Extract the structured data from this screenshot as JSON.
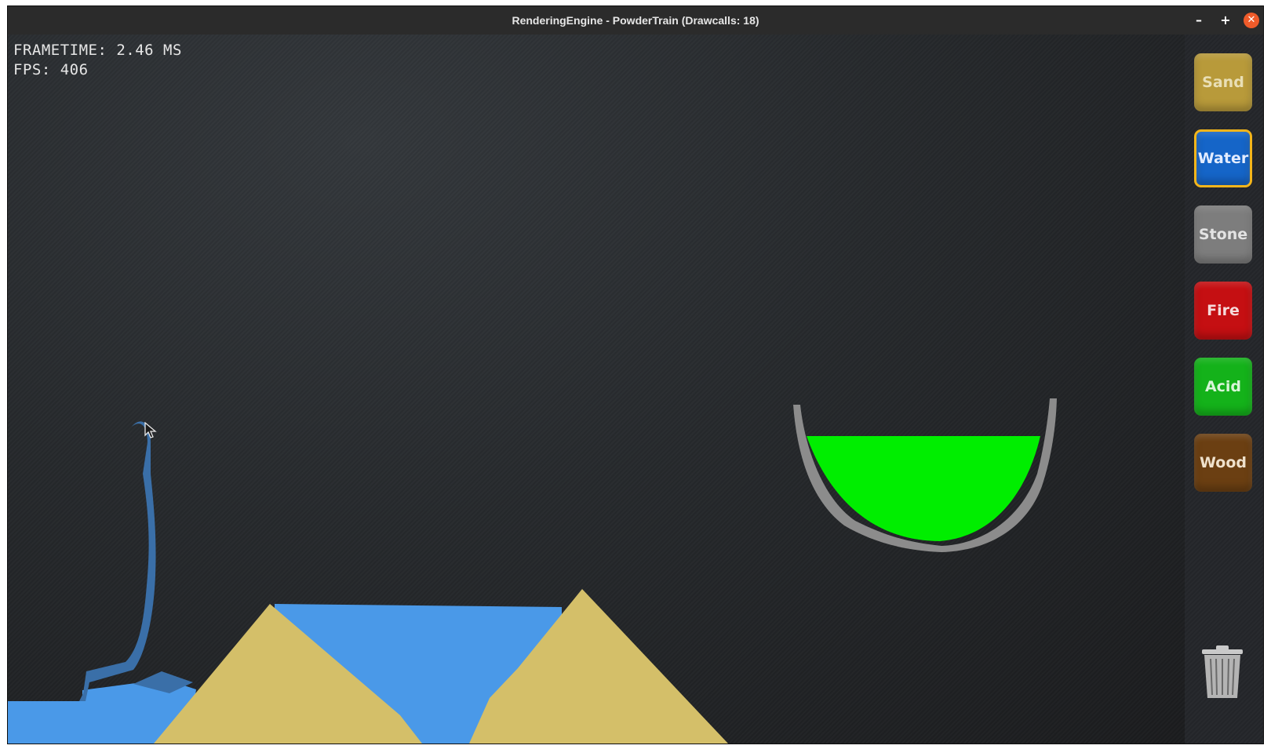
{
  "window": {
    "title": "RenderingEngine - PowderTrain (Drawcalls: 18)",
    "minimize_label": "–",
    "maximize_label": "+",
    "close_label": "✕"
  },
  "hud": {
    "frametime": "FRAMETIME: 2.46 MS",
    "fps": "FPS: 406"
  },
  "materials": [
    {
      "label": "Sand",
      "color": "#b89a3a",
      "text_color": "#e9dfb6",
      "selected": false
    },
    {
      "label": "Water",
      "color": "#1565c8",
      "text_color": "#e2ecff",
      "selected": true
    },
    {
      "label": "Stone",
      "color": "#7d7d7d",
      "text_color": "#e3e3e3",
      "selected": false
    },
    {
      "label": "Fire",
      "color": "#c50f12",
      "text_color": "#f5dada",
      "selected": false
    },
    {
      "label": "Acid",
      "color": "#14b21a",
      "text_color": "#d8f5d8",
      "selected": false
    },
    {
      "label": "Wood",
      "color": "#6b3f12",
      "text_color": "#efe1cc",
      "selected": false
    }
  ],
  "scene_colors": {
    "sand": "#d4bf69",
    "water": "#4a99e8",
    "water_stream": "#3a6fa8",
    "acid": "#00ee00",
    "stone": "#8c8c8c"
  },
  "icons": {
    "trash": "trash-icon",
    "cursor": "mouse-cursor-icon"
  }
}
